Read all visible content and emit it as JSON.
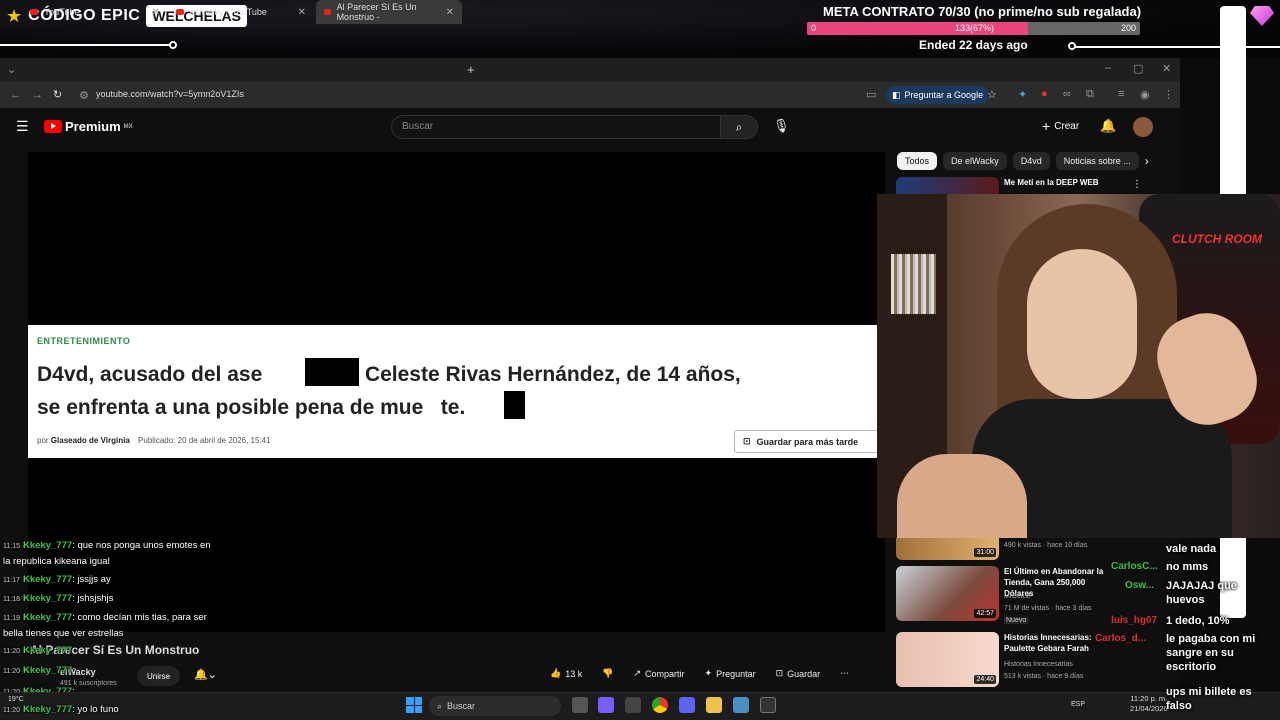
{
  "overlay": {
    "brand_name": "CÓDIGO EPIC",
    "brand_code": "WELCHELAS",
    "meta_title": "META CONTRATO 70/30 (no prime/no sub regalada)",
    "meta_min": "0",
    "meta_progress_label": "133(67%)",
    "meta_max": "200",
    "meta_progress_fraction": 0.665,
    "meta_ended": "Ended 22 days ago",
    "accent_color": "#e8467b"
  },
  "browser": {
    "tabs": [
      {
        "label": "YouTube"
      },
      {
        "label": "elWacky - YouTube"
      },
      {
        "label": "Al Parecer Sí Es Un Monstruo -"
      }
    ],
    "url": "youtube.com/watch?v=5ymn2oV1ZIs",
    "ask_google": "Preguntar a Google"
  },
  "youtube": {
    "logo": "Premium",
    "region": "MX",
    "search_placeholder": "Buscar",
    "create_label": "Crear",
    "chips": [
      "Todos",
      "De elWacky",
      "D4vd",
      "Noticias sobre ..."
    ],
    "article": {
      "category": "ENTRETENIMIENTO",
      "title_line1": "D4vd, acusado del ase        to de Celeste Rivas Hernández, de 14 años,",
      "title_line2": "se enfrenta a una posible pena de mue   te.",
      "by_prefix": "por",
      "author": "Glaseado de Virginia",
      "published": "Publicado: 20 de abril de 2026, 15:41",
      "save_later": "Guardar para más tarde"
    },
    "video_title": "Al Parecer Sí Es Un Monstruo",
    "channel_name": "elWacky",
    "subscribers": "491 k suscriptores",
    "join_label": "Unirse",
    "actions": {
      "likes": "13 k",
      "share": "Compartir",
      "ask": "Preguntar",
      "save": "Guardar"
    },
    "recommendations": [
      {
        "title": "Me Metí en la DEEP WEB",
        "channel": "",
        "meta": "",
        "duration": ""
      },
      {
        "title": "",
        "channel": "",
        "meta": "490 k vistas · hace 10 días",
        "duration": "31:00"
      },
      {
        "title": "El Último en Abandonar la Tienda, Gana 250,000 Dólares",
        "channel": "MrBeast",
        "meta": "71 M de vistas · hace 3 días",
        "badge": "Nuevo",
        "duration": "42:57"
      },
      {
        "title": "Historias Innecesarias: Paulette Gebara Farah",
        "channel": "Historias Innecesarias",
        "meta": "513 k vistas · hace 9 días",
        "duration": "24:40"
      }
    ]
  },
  "webcam": {
    "chair_text": "CLUTCH ROOM"
  },
  "chat_left": [
    {
      "time": "11:15",
      "user": "keky_777",
      "msg": "que nos ponga unos emotes en la republica kikeana igual"
    },
    {
      "time": "11:17",
      "user": "keky_777",
      "msg": "jssjjs ay"
    },
    {
      "time": "11:18",
      "user": "keky_777",
      "msg": "jshsjshjs"
    },
    {
      "time": "11:19",
      "user": "keky_777",
      "msg": "como decían mis tias, para ser bella tienes que ver estrellas"
    },
    {
      "time": "11:20",
      "user": "keky_777",
      "msg": ""
    },
    {
      "time": "11:20",
      "user": "keky_777",
      "msg": ""
    },
    {
      "time": "11:20",
      "user": "keky_777",
      "msg": ""
    },
    {
      "time": "11:20",
      "user": "keky_777",
      "msg": "yo lo funo"
    }
  ],
  "chat_right": {
    "names": [
      "CarlosC...",
      "Osw...",
      "luis_hg07",
      "Carlos_d..."
    ],
    "messages": [
      "vale nada",
      "no mms",
      "JAJAJAJ que huevos",
      "1 dedo, 10%",
      "le pagaba con mi sangre en su escritorio",
      "ups mi billete es falso"
    ]
  },
  "taskbar": {
    "search": "Buscar",
    "lang": "ESP",
    "time": "11:20 p. m.",
    "date": "21/04/2026",
    "weather": "19°C"
  }
}
